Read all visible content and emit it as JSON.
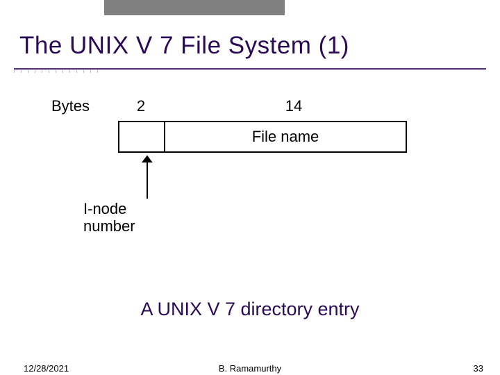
{
  "title": "The UNIX V 7 File System (1)",
  "diagram": {
    "bytes_label": "Bytes",
    "col2": "2",
    "col14": "14",
    "filename": "File name",
    "inode_line1": "I-node",
    "inode_line2": "number"
  },
  "caption": "A UNIX V 7 directory entry",
  "footer": {
    "date": "12/28/2021",
    "author": "B. Ramamurthy",
    "page": "33"
  }
}
